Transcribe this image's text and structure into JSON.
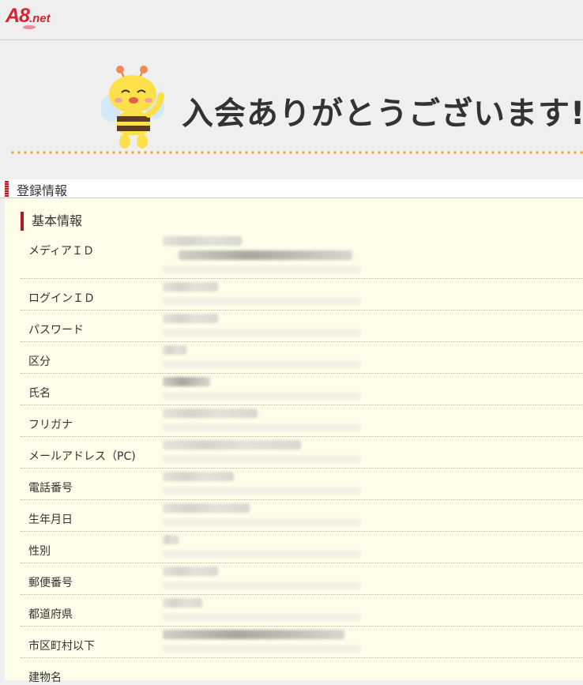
{
  "header": {
    "logo_main": "A8",
    "logo_suffix": ".net"
  },
  "banner": {
    "mascot": "bee-mascot-icon",
    "thanks_text": "入会ありがとうございます!"
  },
  "section": {
    "title": "登録情報",
    "subsection_title": "基本情報"
  },
  "fields": [
    {
      "label": "メディアＩＤ",
      "value_hidden": true
    },
    {
      "label": "ログインＩＤ",
      "value_hidden": true
    },
    {
      "label": "パスワード",
      "value_hidden": true
    },
    {
      "label": "区分",
      "value_hidden": true
    },
    {
      "label": "氏名",
      "value_hidden": true
    },
    {
      "label": "フリガナ",
      "value_hidden": true
    },
    {
      "label": "メールアドレス（PC)",
      "value_hidden": true
    },
    {
      "label": "電話番号",
      "value_hidden": true
    },
    {
      "label": "生年月日",
      "value_hidden": true
    },
    {
      "label": "性別",
      "value_hidden": true
    },
    {
      "label": "郵便番号",
      "value_hidden": true
    },
    {
      "label": "都道府県",
      "value_hidden": true
    },
    {
      "label": "市区町村以下",
      "value_hidden": true
    },
    {
      "label": "建物名",
      "value_hidden": true
    }
  ],
  "colors": {
    "brand_red": "#d9232e",
    "accent_dots": "#f0a040",
    "panel_bg": "#fdfde9"
  }
}
